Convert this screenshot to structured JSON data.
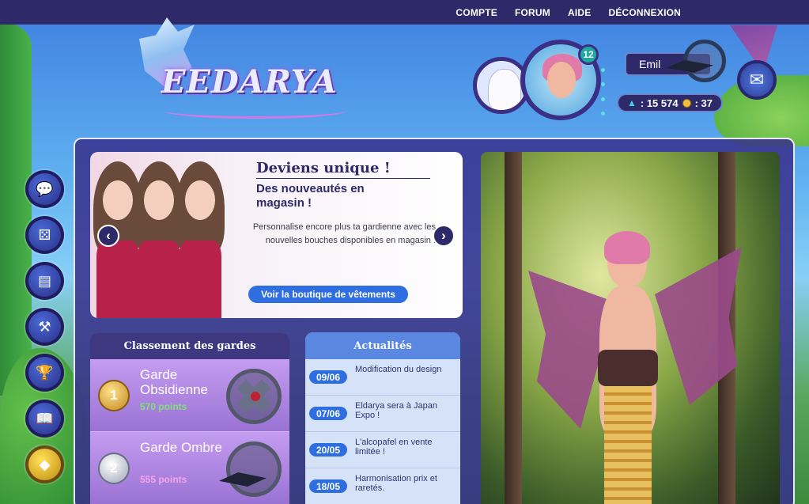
{
  "topnav": {
    "items": [
      "COMPTE",
      "FORUM",
      "AIDE",
      "DÉCONNEXION"
    ]
  },
  "logo": {
    "text": "EEDARYA"
  },
  "profile": {
    "level": "12",
    "name": "Emil",
    "maana": ": 15 574",
    "coins": ": 37",
    "icons": [
      "pet-cat-icon",
      "avatar-portrait",
      "guard-emblem-icon",
      "maana-icon",
      "coin-icon",
      "mail-icon"
    ]
  },
  "side_menu": {
    "icons": [
      "chat-icon",
      "dice-icon",
      "shop-icon",
      "auction-hammer-icon",
      "trophy-icon",
      "book-icon",
      "diamond-icon"
    ]
  },
  "hero": {
    "title": "Deviens unique !",
    "subtitle": "Des nouveautés en magasin !",
    "text": "Personnalise encore plus ta gardienne avec les nouvelles bouches disponibles en magasin !",
    "button": "Voir la boutique de vêtements",
    "prev": "‹",
    "next": "›"
  },
  "ranking": {
    "title": "Classement des gardes",
    "rows": [
      {
        "rank": "1",
        "name": "Garde Obsidienne",
        "points": "570 points",
        "points_color": "#7fe07a"
      },
      {
        "rank": "2",
        "name": "Garde Ombre",
        "points": "555 points",
        "points_color": "#f5a6e8"
      }
    ]
  },
  "news": {
    "title": "Actualités",
    "items": [
      {
        "date": "09/06",
        "title": "Modification du design"
      },
      {
        "date": "07/06",
        "title": "Eldarya sera à Japan Expo !"
      },
      {
        "date": "20/05",
        "title": "L'alcopafel en vente limitée !"
      },
      {
        "date": "18/05",
        "title": "Harmonisation prix et raretés."
      }
    ]
  },
  "colors": {
    "topbar": "#2e2a6a",
    "panel": "#38308c",
    "accent_blue": "#2f6ee0",
    "level_badge": "#1fa8a0"
  }
}
